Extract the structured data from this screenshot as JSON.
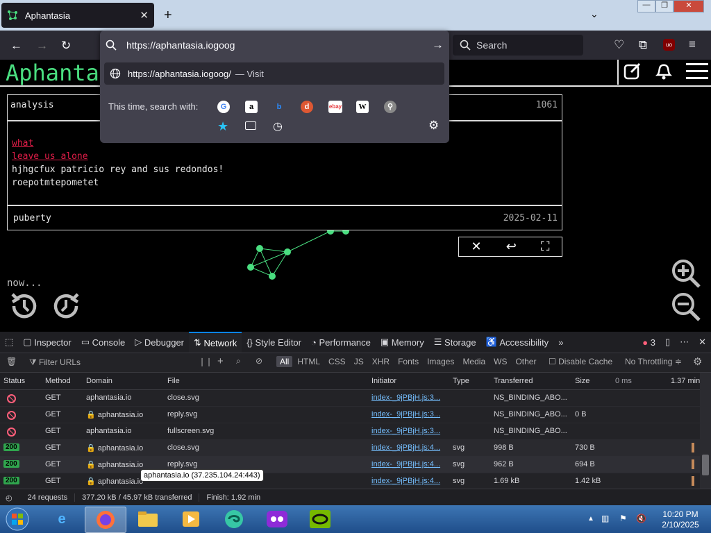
{
  "browser": {
    "tab_title": "Aphantasia",
    "tab_close": "✕",
    "new_tab": "+",
    "tab_list": "⌄",
    "url_value": "https://aphantasia.iogoog",
    "url_suggestion": "https://aphantasia.iogoog/",
    "url_suggestion_action": "— Visit",
    "search_placeholder": "Search",
    "search_with_label": "This time, search with:",
    "window_buttons": [
      "—",
      "❐",
      "✕"
    ]
  },
  "site": {
    "title_visible": "Aphantas",
    "now_text": "now..."
  },
  "card": {
    "top_label": "analysis",
    "top_count": "1061",
    "links": [
      "what",
      "leave us alone"
    ],
    "lines": [
      "hjhgcfux patricio rey and sus redondos!",
      "roepotmtepometet"
    ],
    "foot_label": "puberty",
    "foot_date": "2025-02-11"
  },
  "devtools": {
    "tabs": [
      "Inspector",
      "Console",
      "Debugger",
      "Network",
      "Style Editor",
      "Performance",
      "Memory",
      "Storage",
      "Accessibility"
    ],
    "active_tab": "Network",
    "error_count": "3",
    "filter_placeholder": "Filter URLs",
    "type_filters": [
      "All",
      "HTML",
      "CSS",
      "JS",
      "XHR",
      "Fonts",
      "Images",
      "Media",
      "WS",
      "Other"
    ],
    "disable_cache": "Disable Cache",
    "throttling": "No Throttling ≑",
    "columns": [
      "Status",
      "Method",
      "Domain",
      "File",
      "Initiator",
      "Type",
      "Transferred",
      "Size",
      "0 ms",
      "1.37 min"
    ],
    "rows": [
      {
        "status": "blocked",
        "method": "GET",
        "domain": "aphantasia.io",
        "file": "close.svg",
        "initiator": "index-_9jPBjH.js:3...",
        "type": "",
        "transferred": "NS_BINDING_ABO...",
        "size": ""
      },
      {
        "status": "blocked",
        "method": "GET",
        "domain": "aphantasia.io",
        "file": "reply.svg",
        "initiator": "index-_9jPBjH.js:3...",
        "type": "",
        "transferred": "NS_BINDING_ABO...",
        "size": "0 B"
      },
      {
        "status": "blocked",
        "method": "GET",
        "domain": "aphantasia.io",
        "file": "fullscreen.svg",
        "initiator": "index-_9jPBjH.js:3...",
        "type": "",
        "transferred": "NS_BINDING_ABO...",
        "size": ""
      },
      {
        "status": "200",
        "method": "GET",
        "domain": "aphantasia.io",
        "file": "close.svg",
        "initiator": "index-_9jPBjH.js:4...",
        "type": "svg",
        "transferred": "998 B",
        "size": "730 B"
      },
      {
        "status": "200",
        "method": "GET",
        "domain": "aphantasia.io",
        "file": "reply.svg",
        "initiator": "index-_9jPBjH.js:4...",
        "type": "svg",
        "transferred": "962 B",
        "size": "694 B"
      },
      {
        "status": "200",
        "method": "GET",
        "domain": "aphantasia.io",
        "file": "",
        "initiator": "index-_9jPBjH.js:4...",
        "type": "svg",
        "transferred": "1.69 kB",
        "size": "1.42 kB"
      }
    ],
    "tooltip": "aphantasia.io (37.235.104.24:443)",
    "summary": {
      "requests": "24 requests",
      "transferred": "377.20 kB / 45.97 kB transferred",
      "finish": "Finish: 1.92 min"
    }
  },
  "taskbar": {
    "time": "10:20 PM",
    "date": "2/10/2025"
  },
  "colors": {
    "accent_green": "#4ade80",
    "link_pink": "#e11d48",
    "devtools_blue": "#0a84ff"
  }
}
